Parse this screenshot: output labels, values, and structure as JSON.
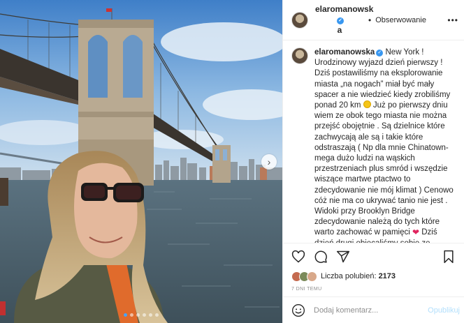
{
  "post": {
    "username": "elaromanowska",
    "username_line1": "elaromanowsk",
    "username_line2": "a",
    "separator": "•",
    "follow_label": "Obserwowanie",
    "more_label": "•••",
    "caption_p1": " New York ! Urodzinowy wyjazd dzień pierwszy ! Dziś postawiliśmy na eksplorowanie miasta „na nogach” miał być mały spacer a nie wiedzieć kiedy zrobiliśmy ponad 20 km ",
    "caption_p2": " Już po pierwszy dniu wiem ze obok tego miasta nie można przejść obojętnie . Są dzielnice które zachwycają ale są i takie które odstraszają ( Np dla mnie Chinatown- mega dużo ludzi na wąskich przestrzeniach plus smród i wszędzie wiszące martwe ptactwo to zdecydowanie nie mój klimat ) Cenowo cóż nie ma co ukrywać tanio nie jest . Widoki przy Brooklyn Bridge zdecydowanie należą do tych które warto zachować w pamięci ",
    "caption_p3": " Dziś dzień drugi obiecaliśmy sobie ze skorzystamy z metra ale coś śmiem",
    "likes_label": "Liczba polubień: ",
    "likes_count": "2173",
    "timestamp": "7 DNI TEMU",
    "comment_placeholder": "Dodaj komentarz...",
    "publish_label": "Opublikuj",
    "carousel_next": "›",
    "carousel_dots": 6,
    "carousel_active_index": 0
  },
  "icons": {
    "like": "heart-outline-icon",
    "comment": "speech-bubble-icon",
    "share": "paper-plane-icon",
    "save": "bookmark-icon",
    "emoji": "smiley-icon",
    "verified": "verified-badge-icon"
  },
  "colors": {
    "verified": "#3897f0",
    "publish_disabled": "#b2dffc",
    "muted_text": "#8e8e8e"
  }
}
